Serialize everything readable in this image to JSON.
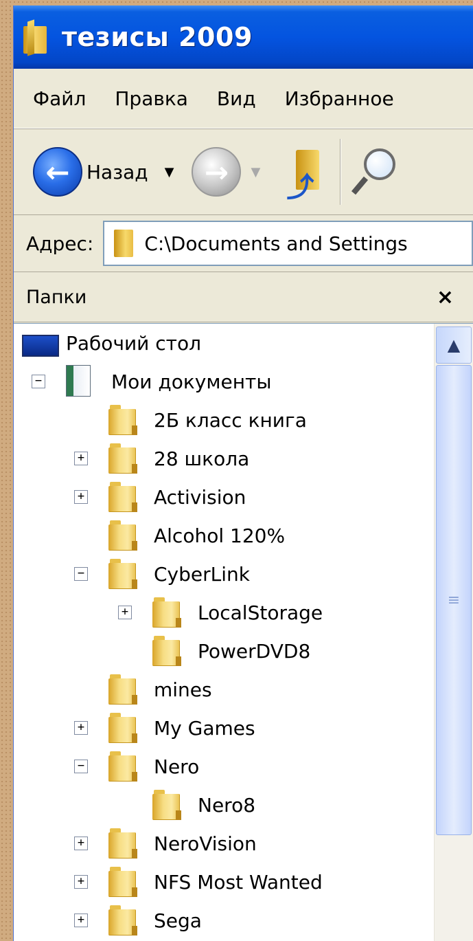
{
  "window": {
    "title": "тезисы 2009"
  },
  "menu": {
    "items": [
      {
        "label": "Файл"
      },
      {
        "label": "Правка"
      },
      {
        "label": "Вид"
      },
      {
        "label": "Избранное"
      }
    ]
  },
  "toolbar": {
    "back_label": "Назад",
    "dropdown_glyph": "▼",
    "back_icon": "arrow-left-icon",
    "forward_icon": "arrow-right-icon",
    "up_icon": "folder-up-icon",
    "search_icon": "search-icon"
  },
  "address": {
    "label": "Адрес:",
    "value": "C:\\Documents and Settings"
  },
  "folders_pane": {
    "title": "Папки",
    "close_glyph": "×"
  },
  "tree": [
    {
      "label": "Рабочий стол",
      "icon": "desktop-icon",
      "expander": ""
    },
    {
      "label": "Мои документы",
      "icon": "my-documents-icon",
      "expander": "−"
    },
    {
      "label": "2Б класс книга",
      "icon": "folder-icon",
      "expander": ""
    },
    {
      "label": "28 школа",
      "icon": "folder-icon",
      "expander": "+"
    },
    {
      "label": "Activision",
      "icon": "folder-icon",
      "expander": "+"
    },
    {
      "label": "Alcohol 120%",
      "icon": "folder-icon",
      "expander": ""
    },
    {
      "label": "CyberLink",
      "icon": "folder-icon",
      "expander": "−"
    },
    {
      "label": "LocalStorage",
      "icon": "folder-icon",
      "expander": "+"
    },
    {
      "label": "PowerDVD8",
      "icon": "folder-icon",
      "expander": ""
    },
    {
      "label": "mines",
      "icon": "folder-icon",
      "expander": ""
    },
    {
      "label": "My Games",
      "icon": "folder-icon",
      "expander": "+"
    },
    {
      "label": "Nero",
      "icon": "folder-icon",
      "expander": "−"
    },
    {
      "label": "Nero8",
      "icon": "folder-icon",
      "expander": ""
    },
    {
      "label": "NeroVision",
      "icon": "folder-icon",
      "expander": "+"
    },
    {
      "label": "NFS Most Wanted",
      "icon": "folder-icon",
      "expander": "+"
    },
    {
      "label": "Sega",
      "icon": "folder-icon",
      "expander": "+"
    }
  ],
  "scrollbar": {
    "up_glyph": "▲",
    "grip_glyph": "≡"
  },
  "colors": {
    "titlebar": "#0454e0",
    "window_face": "#ece9d8",
    "slide_background": "#d0ab80"
  }
}
